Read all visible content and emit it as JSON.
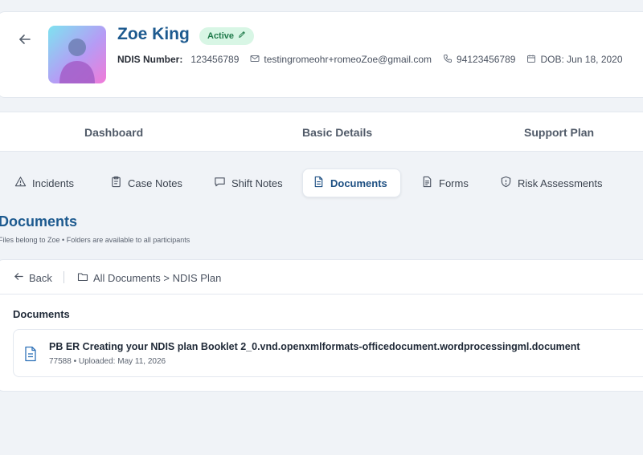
{
  "profile": {
    "name": "Zoe King",
    "status": "Active",
    "ndis_label": "NDIS Number:",
    "ndis_value": "123456789",
    "email": "testingromeohr+romeoZoe@gmail.com",
    "phone": "94123456789",
    "dob": "DOB: Jun 18, 2020"
  },
  "main_tabs": [
    "Dashboard",
    "Basic Details",
    "Support Plan"
  ],
  "sub_tabs": [
    {
      "label": "Incidents",
      "icon": "warning-icon"
    },
    {
      "label": "Case Notes",
      "icon": "clipboard-icon"
    },
    {
      "label": "Shift Notes",
      "icon": "message-icon"
    },
    {
      "label": "Documents",
      "icon": "file-icon",
      "active": true
    },
    {
      "label": "Forms",
      "icon": "form-icon"
    },
    {
      "label": "Risk Assessments",
      "icon": "shield-icon"
    }
  ],
  "section": {
    "title": "Documents",
    "subtitle": "Files belong to Zoe • Folders are available to all participants"
  },
  "panel": {
    "back_label": "Back",
    "breadcrumb": "All Documents > NDIS Plan",
    "heading": "Documents",
    "documents": [
      {
        "name": "PB ER Creating your NDIS plan Booklet 2_0.vnd.openxmlformats-officedocument.wordprocessingml.document",
        "meta": "77588  •  Uploaded: May 11, 2026"
      }
    ]
  },
  "colors": {
    "accent": "#1d5a8f",
    "active_badge_bg": "#d8f6e5",
    "active_badge_text": "#1f7a4a"
  }
}
